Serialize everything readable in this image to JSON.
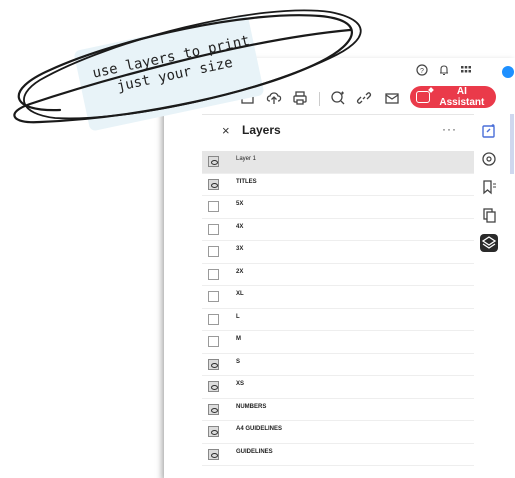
{
  "toolbar": {
    "ai_assistant_label": "AI Assistant"
  },
  "layers_panel": {
    "title": "Layers",
    "close_symbol": "×",
    "more_symbol": "···",
    "layers": [
      {
        "name": "Layer 1",
        "visible": true,
        "selected": true
      },
      {
        "name": "TITLES",
        "visible": true,
        "selected": false
      },
      {
        "name": "5X",
        "visible": false,
        "selected": false
      },
      {
        "name": "4X",
        "visible": false,
        "selected": false
      },
      {
        "name": "3X",
        "visible": false,
        "selected": false
      },
      {
        "name": "2X",
        "visible": false,
        "selected": false
      },
      {
        "name": "XL",
        "visible": false,
        "selected": false
      },
      {
        "name": "L",
        "visible": false,
        "selected": false
      },
      {
        "name": "M",
        "visible": false,
        "selected": false
      },
      {
        "name": "S",
        "visible": true,
        "selected": false
      },
      {
        "name": "XS",
        "visible": true,
        "selected": false
      },
      {
        "name": "NUMBERS",
        "visible": true,
        "selected": false
      },
      {
        "name": "A4 GUIDELINES",
        "visible": true,
        "selected": false
      },
      {
        "name": "GUIDELINES",
        "visible": true,
        "selected": false
      }
    ]
  },
  "annotation": {
    "line1": "use layers to print",
    "line2": "just your size"
  },
  "colors": {
    "ai_button": "#ea3a4a",
    "selected_row": "#e6e6e6",
    "bubble": "#e8f3f8",
    "user_avatar": "#1e90ff"
  },
  "icons": {
    "top": [
      "help-icon",
      "bell-icon",
      "apps-grid-icon",
      "user-avatar"
    ],
    "toolbar": [
      "image-edit-icon",
      "upload-cloud-icon",
      "print-icon",
      "search-comment-icon",
      "link-icon",
      "mail-icon"
    ],
    "rail": [
      "edit-icon",
      "comment-icon",
      "bookmark-icon",
      "pages-icon",
      "layers-icon"
    ]
  }
}
